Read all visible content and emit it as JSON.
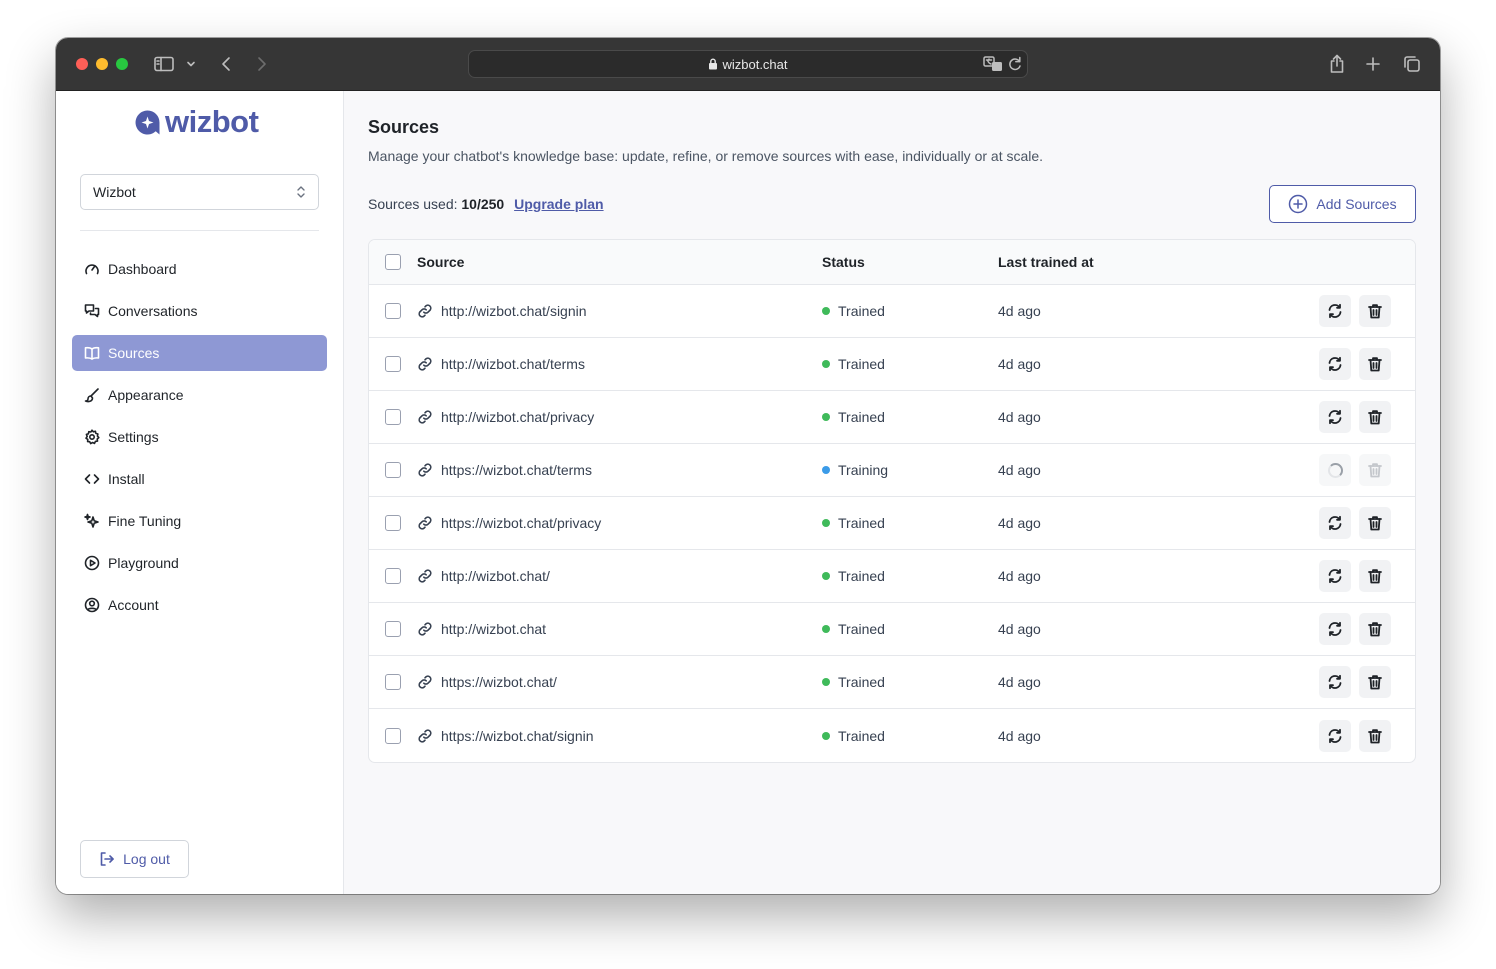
{
  "browser": {
    "url": "wizbot.chat"
  },
  "sidebar": {
    "brand": "wizbot",
    "bot_selector": {
      "value": "Wizbot"
    },
    "nav": [
      {
        "label": "Dashboard",
        "icon": "gauge-icon",
        "active": false
      },
      {
        "label": "Conversations",
        "icon": "chat-bubbles-icon",
        "active": false
      },
      {
        "label": "Sources",
        "icon": "book-open-icon",
        "active": true
      },
      {
        "label": "Appearance",
        "icon": "brush-icon",
        "active": false
      },
      {
        "label": "Settings",
        "icon": "gear-icon",
        "active": false
      },
      {
        "label": "Install",
        "icon": "code-icon",
        "active": false
      },
      {
        "label": "Fine Tuning",
        "icon": "sparkles-icon",
        "active": false
      },
      {
        "label": "Playground",
        "icon": "play-circle-icon",
        "active": false
      },
      {
        "label": "Account",
        "icon": "user-circle-icon",
        "active": false
      }
    ],
    "logout_label": "Log out"
  },
  "main": {
    "title": "Sources",
    "description": "Manage your chatbot's knowledge base: update, refine, or remove sources with ease, individually or at scale.",
    "usage_label": "Sources used:",
    "usage_value": "10/250",
    "upgrade_link": "Upgrade plan",
    "add_button": "Add Sources",
    "table": {
      "headers": {
        "source": "Source",
        "status": "Status",
        "last_trained": "Last trained at"
      },
      "rows": [
        {
          "source": "http://wizbot.chat/signin",
          "status": "Trained",
          "last_trained": "4d ago"
        },
        {
          "source": "http://wizbot.chat/terms",
          "status": "Trained",
          "last_trained": "4d ago"
        },
        {
          "source": "http://wizbot.chat/privacy",
          "status": "Trained",
          "last_trained": "4d ago"
        },
        {
          "source": "https://wizbot.chat/terms",
          "status": "Training",
          "last_trained": "4d ago"
        },
        {
          "source": "https://wizbot.chat/privacy",
          "status": "Trained",
          "last_trained": "4d ago"
        },
        {
          "source": "http://wizbot.chat/",
          "status": "Trained",
          "last_trained": "4d ago"
        },
        {
          "source": "http://wizbot.chat",
          "status": "Trained",
          "last_trained": "4d ago"
        },
        {
          "source": "https://wizbot.chat/",
          "status": "Trained",
          "last_trained": "4d ago"
        },
        {
          "source": "https://wizbot.chat/signin",
          "status": "Trained",
          "last_trained": "4d ago"
        }
      ]
    }
  },
  "colors": {
    "brand": "#4f5ba8",
    "active_nav": "#8e98d4",
    "trained": "#3fba5a",
    "training": "#3b9be8"
  }
}
